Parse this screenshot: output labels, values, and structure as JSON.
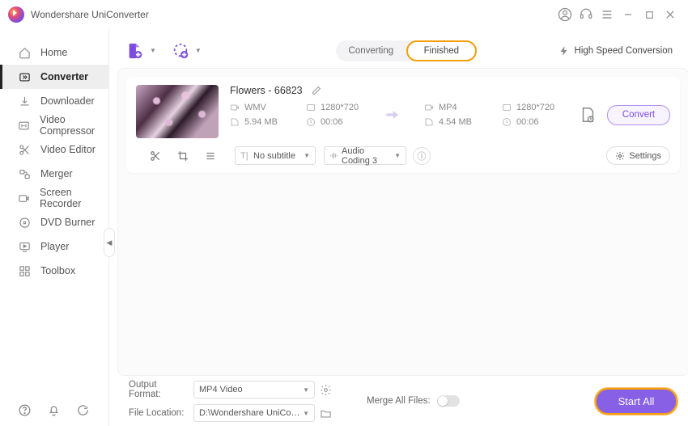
{
  "app": {
    "title": "Wondershare UniConverter"
  },
  "sidebar": {
    "items": [
      {
        "label": "Home"
      },
      {
        "label": "Converter"
      },
      {
        "label": "Downloader"
      },
      {
        "label": "Video Compressor"
      },
      {
        "label": "Video Editor"
      },
      {
        "label": "Merger"
      },
      {
        "label": "Screen Recorder"
      },
      {
        "label": "DVD Burner"
      },
      {
        "label": "Player"
      },
      {
        "label": "Toolbox"
      }
    ]
  },
  "tabs": {
    "converting": "Converting",
    "finished": "Finished"
  },
  "high_speed": "High Speed Conversion",
  "file": {
    "title": "Flowers - 66823",
    "src": {
      "format": "WMV",
      "res": "1280*720",
      "size": "5.94 MB",
      "dur": "00:06"
    },
    "dst": {
      "format": "MP4",
      "res": "1280*720",
      "size": "4.54 MB",
      "dur": "00:06"
    },
    "subtitle": "No subtitle",
    "audio": "Audio Coding 3",
    "settings": "Settings",
    "convert": "Convert"
  },
  "footer": {
    "output_format_label": "Output Format:",
    "output_format_value": "MP4 Video",
    "location_label": "File Location:",
    "location_value": "D:\\Wondershare UniConverter",
    "merge_label": "Merge All Files:",
    "start_all": "Start All"
  }
}
